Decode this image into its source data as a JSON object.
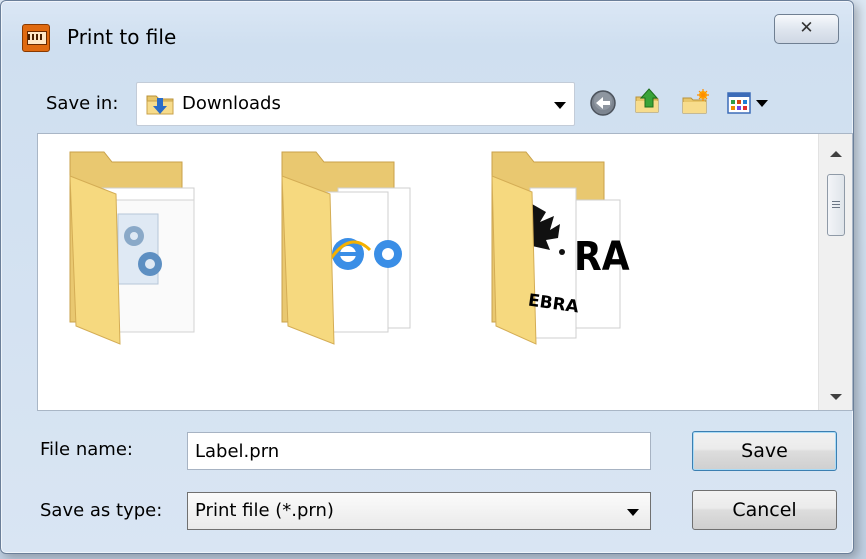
{
  "window": {
    "title": "Print to file",
    "close_glyph": "✕"
  },
  "save_in": {
    "label": "Save in:",
    "value": "Downloads"
  },
  "toolbar": {
    "icons": [
      "back-icon",
      "up-folder-icon",
      "new-folder-icon",
      "view-menu-icon"
    ]
  },
  "files": {
    "items": [
      {
        "icon": "folder-icon",
        "preview": "settings-gears"
      },
      {
        "icon": "folder-icon",
        "preview": "internet-explorer-docs"
      },
      {
        "icon": "folder-icon",
        "preview": "zebra-logo",
        "preview_text_right": "RA",
        "preview_text_bottom": "EBRA"
      }
    ]
  },
  "file_name": {
    "label": "File name:",
    "value": "Label.prn"
  },
  "save_as_type": {
    "label": "Save as type:",
    "value": "Print file (*.prn)"
  },
  "buttons": {
    "save": "Save",
    "cancel": "Cancel"
  },
  "colors": {
    "dialog_bg": "#d9e5f3",
    "folder_yellow": "#f5d87a",
    "default_button_border": "#3c7fb1"
  }
}
